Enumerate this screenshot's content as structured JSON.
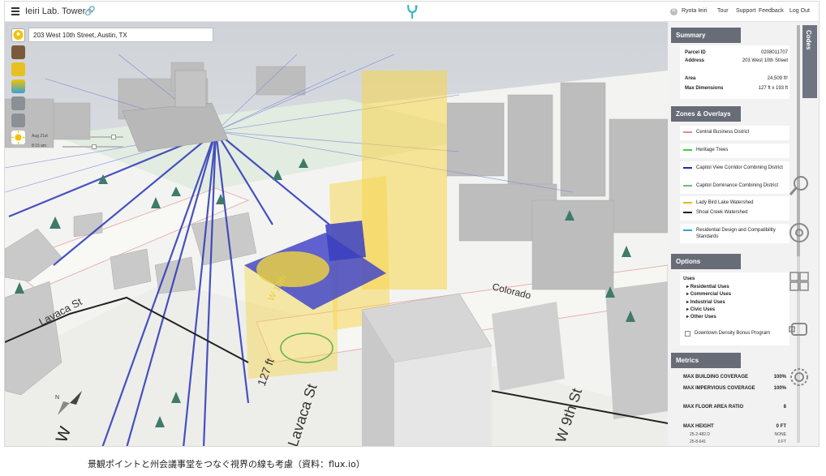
{
  "header": {
    "project_title": "Ieiri Lab. Tower",
    "user_initial": "R",
    "user_name": "Ryota Ieiri",
    "nav": [
      "Tour",
      "Support",
      "Feedback",
      "Log Out"
    ]
  },
  "map": {
    "address": "203 West 10th Street, Austin, TX",
    "time": {
      "date": "Aug 21st",
      "clock": "8:15 am"
    },
    "street_labels": [
      "Lavaca St",
      "Colorado",
      "W 10th",
      "127 ft",
      "Lavaca St",
      "W 9th St"
    ],
    "compass_letters": [
      "N",
      "W"
    ]
  },
  "sidebar": {
    "codes_label": "Codes",
    "summary": {
      "title": "Summary",
      "rows": [
        {
          "key": "Parcel ID",
          "value": "0208011707"
        },
        {
          "key": "Address",
          "value": "203 West 10th Street"
        },
        {
          "key": "Area",
          "value": "24,509 ft²"
        },
        {
          "key": "Max Dimensions",
          "value": "127 ft x 193 ft"
        }
      ]
    },
    "zones": {
      "title": "Zones & Overlays",
      "items": [
        {
          "label": "Central Business District",
          "color": "#e88a8a"
        },
        {
          "label": "Heritage Trees",
          "color": "#44cc44"
        },
        {
          "label": "Capitol View Corridor Combining District",
          "color": "#1f2aa8"
        },
        {
          "label": "Capitol Dominance Combining District",
          "color": "#6fbf6f"
        },
        {
          "label": "Lady Bird Lake Watershed",
          "color": "#e8b820"
        },
        {
          "label": "Shoal Creek Watershed",
          "color": "#222222"
        },
        {
          "label": "Residential Design and Compatibility Standards",
          "color": "#3aa0d8"
        }
      ]
    },
    "options": {
      "title": "Options",
      "uses_label": "Uses",
      "uses": [
        "Residential Uses",
        "Commercial Uses",
        "Industrial Uses",
        "Civic Uses",
        "Other Uses"
      ],
      "checkbox_label": "Downtown Density Bonus Program"
    },
    "metrics": {
      "title": "Metrics",
      "rows": [
        {
          "key": "MAX BUILDING COVERAGE",
          "value": "100%"
        },
        {
          "key": "MAX IMPERVIOUS COVERAGE",
          "value": "100%"
        },
        {
          "key": "MAX FLOOR AREA RATIO",
          "value": "8"
        },
        {
          "key": "MAX HEIGHT",
          "value": "0 FT"
        }
      ],
      "sub_rows": [
        {
          "key": "25-2-482.D",
          "value": "NONE"
        },
        {
          "key": "25-8-641",
          "value": "0 FT"
        }
      ]
    }
  },
  "caption": "景観ポイントと州会議事堂をつなぐ視界の線も考慮（資料：flux.io）",
  "colors": {
    "panel_header": "#676c76",
    "accent_yellow": "#f2c200",
    "parcel_blue": "#3c3cc8"
  }
}
